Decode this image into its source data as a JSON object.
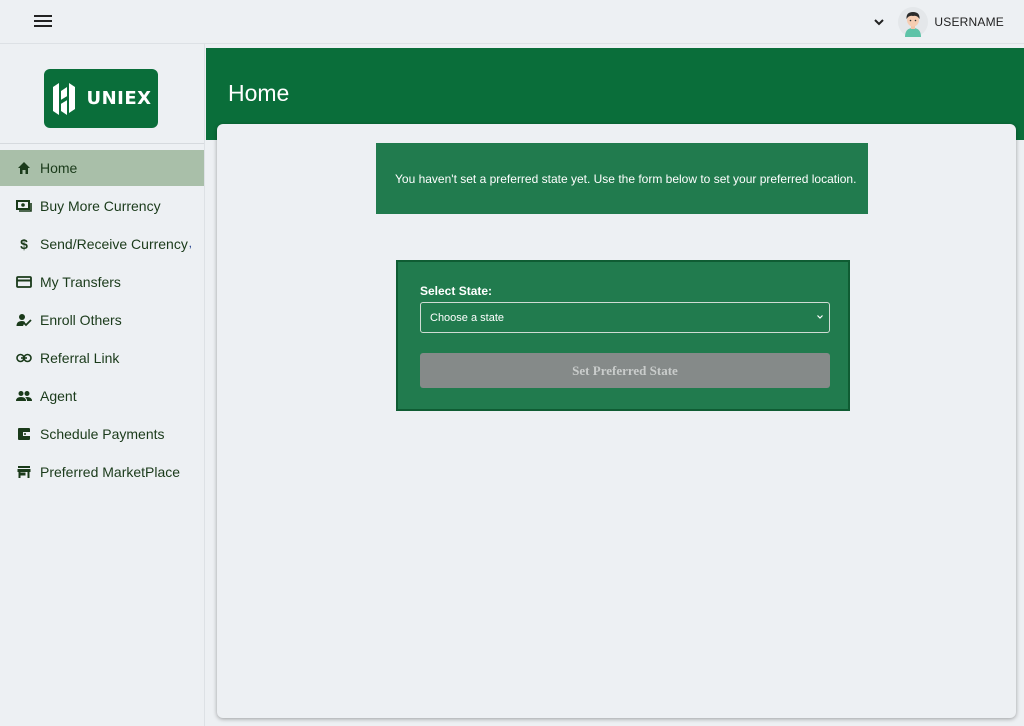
{
  "topbar": {
    "menu_icon": "hamburger-menu-icon",
    "dropdown_icon": "chevron-down-icon",
    "username": "USERNAME"
  },
  "brand": {
    "logo_text": "UNIEX",
    "color": "#0a6e3a"
  },
  "sidebar": {
    "items": [
      {
        "label": "Home",
        "icon": "home-icon",
        "active": true
      },
      {
        "label": "Buy More Currency",
        "icon": "cash-icon"
      },
      {
        "label": "Send/Receive Currency",
        "icon": "dollar-icon"
      },
      {
        "label": "My Transfers",
        "icon": "card-icon"
      },
      {
        "label": "Enroll Others",
        "icon": "person-check-icon"
      },
      {
        "label": "Referral Link",
        "icon": "link-icon"
      },
      {
        "label": "Agent",
        "icon": "people-icon"
      },
      {
        "label": "Schedule Payments",
        "icon": "wallet-icon"
      },
      {
        "label": "Preferred MarketPlace",
        "icon": "store-icon"
      }
    ],
    "stray_mark": ","
  },
  "header": {
    "title": "Home"
  },
  "alert": {
    "message": "You haven't set a preferred state yet. Use the form below to set your preferred location."
  },
  "form": {
    "label": "Select State:",
    "select_value": "Choose a state",
    "submit_label": "Set Preferred State"
  }
}
